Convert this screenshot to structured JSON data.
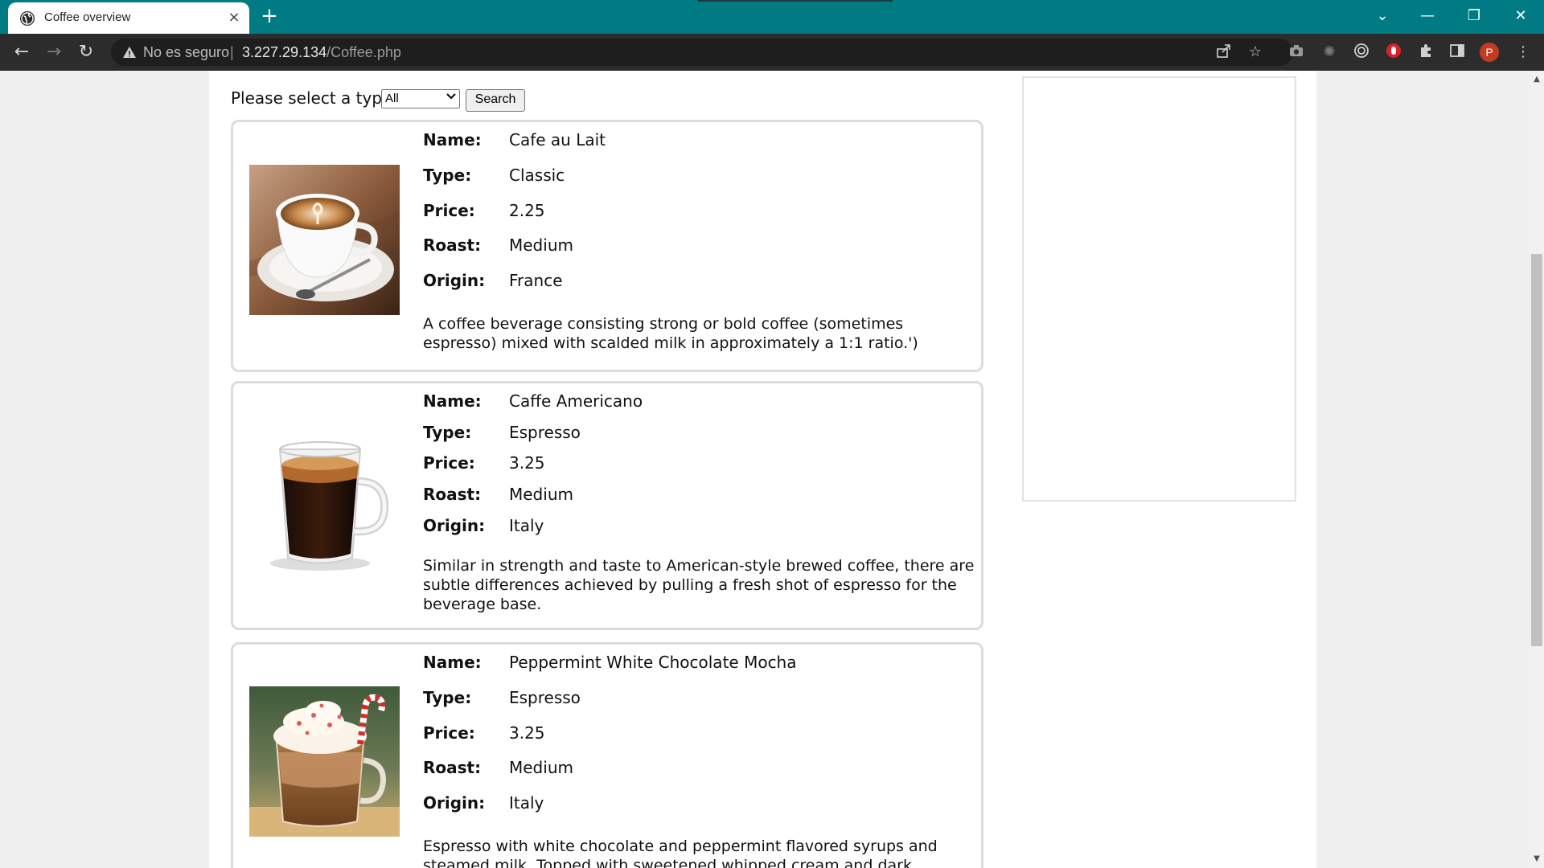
{
  "browser": {
    "tab_title": "Coffee overview",
    "tab_close": "×",
    "new_tab": "+",
    "address_security": "No es seguro",
    "address_separator": "|",
    "address_host": "3.227.29.134",
    "address_path": "/Coffee.php",
    "profile_initial": "P",
    "tab_bar_color": "#007b83",
    "toolbar_color": "#2c2c2c",
    "window_controls": {
      "tab_search": "⌄",
      "minimize": "—",
      "restore": "❐",
      "close": "✕"
    },
    "nav": {
      "back": "←",
      "forward": "→",
      "reload": "↻"
    },
    "toolbar_icons": [
      "share-icon",
      "bookmark-star-icon",
      "camera-icon",
      "extension-icon",
      "target-icon",
      "extension-red-icon",
      "puzzle-icon",
      "sidebar-icon",
      "kebab-menu-icon"
    ]
  },
  "filter": {
    "label": "Please select a type:",
    "selected": "All",
    "search_label": "Search"
  },
  "field_labels": {
    "name": "Name:",
    "type": "Type:",
    "price": "Price:",
    "roast": "Roast:",
    "origin": "Origin:"
  },
  "coffees": [
    {
      "name": "Cafe au Lait",
      "type": "Classic",
      "price": "2.25",
      "roast": "Medium",
      "origin": "France",
      "description": "A coffee beverage consisting strong or bold coffee (sometimes espresso) mixed with scalded milk in approximately a 1:1 ratio.')"
    },
    {
      "name": "Caffe Americano",
      "type": "Espresso",
      "price": "3.25",
      "roast": "Medium",
      "origin": "Italy",
      "description": "Similar in strength and taste to American-style brewed coffee, there are subtle differences achieved by pulling a fresh shot of espresso for the beverage base."
    },
    {
      "name": "Peppermint White Chocolate Mocha",
      "type": "Espresso",
      "price": "3.25",
      "roast": "Medium",
      "origin": "Italy",
      "description": "Espresso with white chocolate and peppermint flavored syrups and steamed milk. Topped with sweetened whipped cream and dark chocolate curls."
    }
  ]
}
